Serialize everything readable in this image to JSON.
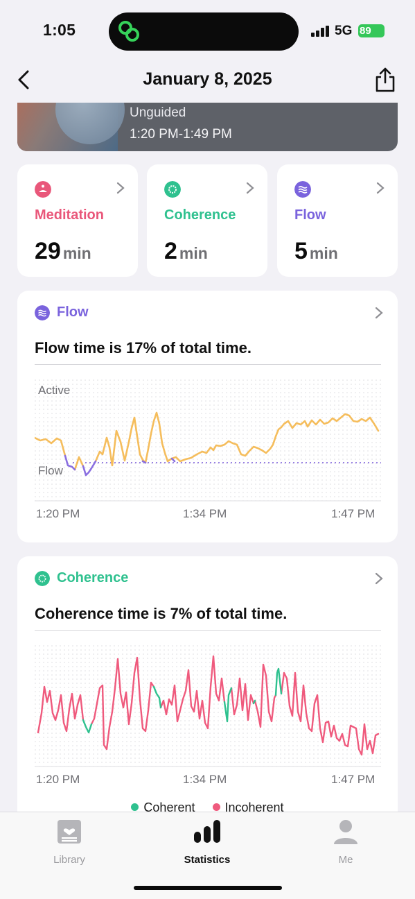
{
  "status_bar": {
    "time": "1:05",
    "network": "5G",
    "battery": "89"
  },
  "header": {
    "title": "January 8, 2025"
  },
  "session": {
    "type": "Unguided",
    "time_range": "1:20 PM-1:49 PM"
  },
  "stats": [
    {
      "label": "Meditation",
      "value": "29",
      "unit": "min",
      "color": "#e9577a"
    },
    {
      "label": "Coherence",
      "value": "2",
      "unit": "min",
      "color": "#2fc18f"
    },
    {
      "label": "Flow",
      "value": "5",
      "unit": "min",
      "color": "#7a63dd"
    }
  ],
  "flow_card": {
    "label": "Flow",
    "summary": "Flow time is 17% of total time.",
    "y_top_label": "Active",
    "y_bottom_label": "Flow",
    "x_labels": [
      "1:20 PM",
      "1:34 PM",
      "1:47 PM"
    ]
  },
  "coherence_card": {
    "label": "Coherence",
    "summary": "Coherence time is 7% of total time.",
    "x_labels": [
      "1:20 PM",
      "1:34 PM",
      "1:47 PM"
    ],
    "legend": [
      "Coherent",
      "Incoherent"
    ]
  },
  "tabs": [
    {
      "label": "Library",
      "icon": "library-icon"
    },
    {
      "label": "Statistics",
      "icon": "statistics-icon"
    },
    {
      "label": "Me",
      "icon": "profile-icon"
    }
  ],
  "colors": {
    "flow_active": "#f5bd5c",
    "flow_state": "#8a6fe0",
    "coherent": "#2fc18f",
    "incoherent": "#ef5a7d"
  }
}
